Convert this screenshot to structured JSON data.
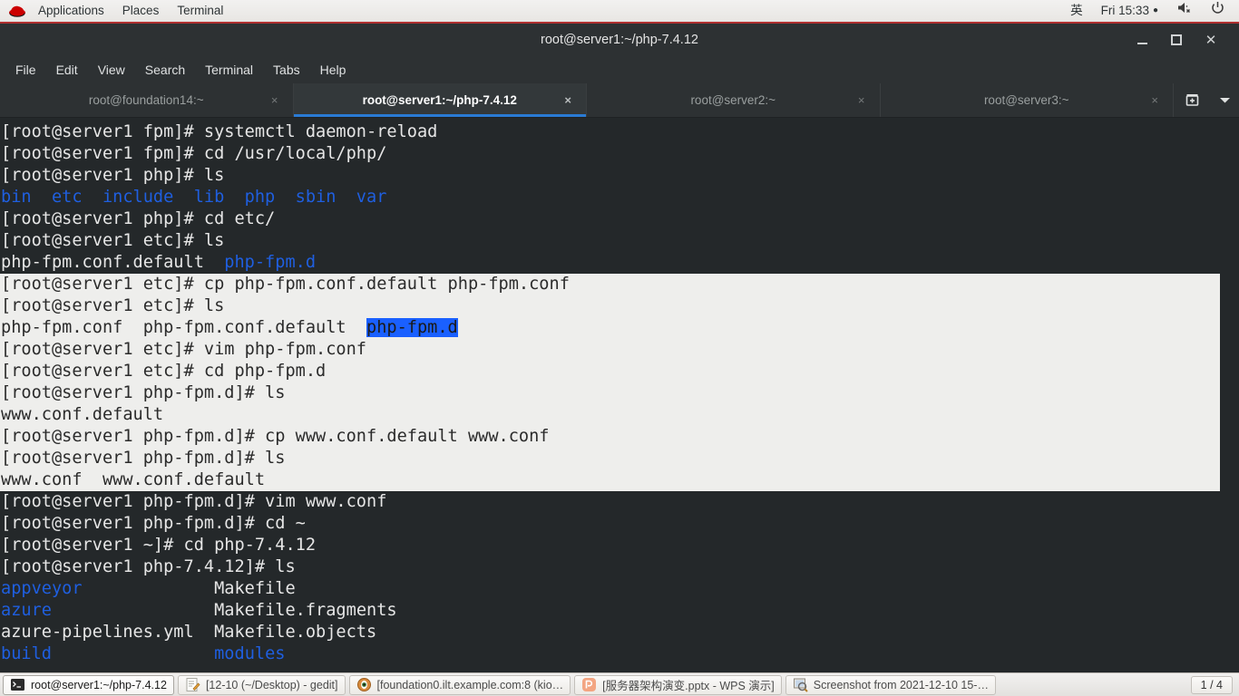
{
  "top_panel": {
    "logo": "redhat-logo",
    "menus": [
      "Applications",
      "Places",
      "Terminal"
    ],
    "input_method": "英",
    "clock": "Fri 15:33",
    "clock_dot": "●",
    "volume_icon": "volume-muted-icon",
    "power_icon": "power-icon"
  },
  "window": {
    "title": "root@server1:~/php-7.4.12",
    "minimize_label": "—",
    "maximize_label": "□",
    "close_label": "✕"
  },
  "menubar": {
    "items": [
      "File",
      "Edit",
      "View",
      "Search",
      "Terminal",
      "Tabs",
      "Help"
    ]
  },
  "tabs": {
    "close_glyph": "×",
    "items": [
      {
        "label": "root@foundation14:~",
        "active": false
      },
      {
        "label": "root@server1:~/php-7.4.12",
        "active": true
      },
      {
        "label": "root@server2:~",
        "active": false
      },
      {
        "label": "root@server3:~",
        "active": false
      }
    ],
    "new_tab_icon": "add-tab-icon",
    "dropdown_icon": "chevron-down-icon"
  },
  "terminal": {
    "colors": {
      "background": "#24282a",
      "foreground": "#e6e6e6",
      "directory_blue": "#1f5fe0",
      "selection_background": "#eeeeec",
      "selection_foreground": "#2b2b2b",
      "highlight_background": "#1a60ff"
    },
    "lines": [
      {
        "selected": false,
        "segments": [
          {
            "t": "[root@server1 fpm]# systemctl daemon-reload"
          }
        ]
      },
      {
        "selected": false,
        "segments": [
          {
            "t": "[root@server1 fpm]# cd /usr/local/php/"
          }
        ]
      },
      {
        "selected": false,
        "segments": [
          {
            "t": "[root@server1 php]# ls"
          }
        ]
      },
      {
        "selected": false,
        "segments": [
          {
            "t": "bin  etc  include  lib  php  sbin  var",
            "c": "blue"
          }
        ]
      },
      {
        "selected": false,
        "segments": [
          {
            "t": "[root@server1 php]# cd etc/"
          }
        ]
      },
      {
        "selected": false,
        "segments": [
          {
            "t": "[root@server1 etc]# ls"
          }
        ]
      },
      {
        "selected": false,
        "segments": [
          {
            "t": "php-fpm.conf.default  "
          },
          {
            "t": "php-fpm.d",
            "c": "blue"
          }
        ]
      },
      {
        "selected": true,
        "segments": [
          {
            "t": "[root@server1 etc]# cp php-fpm.conf.default php-fpm.conf"
          }
        ]
      },
      {
        "selected": true,
        "segments": [
          {
            "t": "[root@server1 etc]# ls"
          }
        ]
      },
      {
        "selected": true,
        "segments": [
          {
            "t": "php-fpm.conf  php-fpm.conf.default  "
          },
          {
            "t": "php-fpm.d",
            "c": "hl"
          }
        ]
      },
      {
        "selected": true,
        "segments": [
          {
            "t": "[root@server1 etc]# vim php-fpm.conf"
          }
        ]
      },
      {
        "selected": true,
        "segments": [
          {
            "t": "[root@server1 etc]# cd php-fpm.d"
          }
        ]
      },
      {
        "selected": true,
        "segments": [
          {
            "t": "[root@server1 php-fpm.d]# ls"
          }
        ]
      },
      {
        "selected": true,
        "segments": [
          {
            "t": "www.conf.default"
          }
        ]
      },
      {
        "selected": true,
        "segments": [
          {
            "t": "[root@server1 php-fpm.d]# cp www.conf.default www.conf"
          }
        ]
      },
      {
        "selected": true,
        "segments": [
          {
            "t": "[root@server1 php-fpm.d]# ls"
          }
        ]
      },
      {
        "selected": true,
        "segments": [
          {
            "t": "www.conf  www.conf.default"
          }
        ]
      },
      {
        "selected": false,
        "segments": [
          {
            "t": "[root@server1 php-fpm.d]# vim www.conf"
          }
        ]
      },
      {
        "selected": false,
        "segments": [
          {
            "t": "[root@server1 php-fpm.d]# cd ~"
          }
        ]
      },
      {
        "selected": false,
        "segments": [
          {
            "t": "[root@server1 ~]# cd php-7.4.12"
          }
        ]
      },
      {
        "selected": false,
        "segments": [
          {
            "t": "[root@server1 php-7.4.12]# ls"
          }
        ]
      },
      {
        "selected": false,
        "segments": [
          {
            "t": "appveyor",
            "c": "blue"
          },
          {
            "t": "             Makefile"
          }
        ]
      },
      {
        "selected": false,
        "segments": [
          {
            "t": "azure",
            "c": "blue"
          },
          {
            "t": "                Makefile.fragments"
          }
        ]
      },
      {
        "selected": false,
        "segments": [
          {
            "t": "azure-pipelines.yml  Makefile.objects"
          }
        ]
      },
      {
        "selected": false,
        "segments": [
          {
            "t": "build",
            "c": "blue"
          },
          {
            "t": "                "
          },
          {
            "t": "modules",
            "c": "blue"
          }
        ]
      }
    ]
  },
  "taskbar": {
    "items": [
      {
        "label": "root@server1:~/php-7.4.12",
        "icon": "terminal-icon",
        "active": true
      },
      {
        "label": "[12-10 (~/Desktop) - gedit]",
        "icon": "gedit-icon",
        "active": false
      },
      {
        "label": "[foundation0.ilt.example.com:8 (kio…",
        "icon": "remote-viewer-icon",
        "active": false
      },
      {
        "label": "[服务器架构演变.pptx - WPS 演示]",
        "icon": "wps-presentation-icon",
        "active": false
      },
      {
        "label": "Screenshot from 2021-12-10 15-…",
        "icon": "screenshot-icon",
        "active": false
      }
    ],
    "workspace": "1 / 4"
  }
}
